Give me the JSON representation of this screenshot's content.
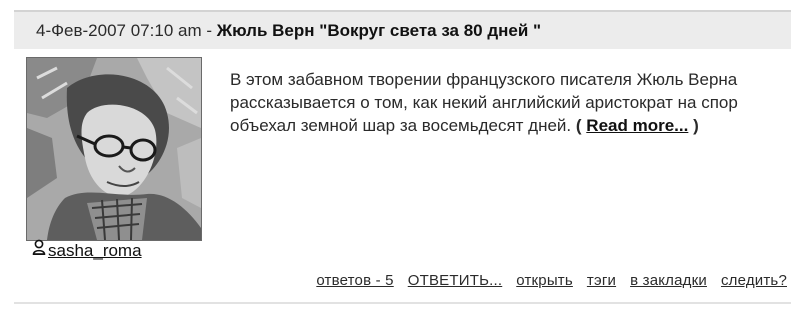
{
  "post": {
    "date": "4-Фев-2007 07:10 am",
    "separator": " - ",
    "title": "Жюль Верн \"Вокруг света за 80 дней \"",
    "body": "В этом забавном творении французского писателя Жюль Верна рассказывается о том, как некий английский аристократ на спор объехал земной шар за восемьдесят дней.",
    "read_more_open": "(",
    "read_more_label": "Read more...",
    "read_more_close": ")",
    "author": "sasha_roma"
  },
  "actions": {
    "replies": "ответов - 5",
    "reply": "ОТВЕТИТЬ...",
    "open": "открыть",
    "tags": "тэги",
    "bookmark": "в закладки",
    "follow": "следить?"
  },
  "icons": {
    "author": "user-icon",
    "avatar": "avatar-photo"
  },
  "colors": {
    "header_background": "#ececec",
    "link": "#111111",
    "text": "#2a2a2a"
  }
}
